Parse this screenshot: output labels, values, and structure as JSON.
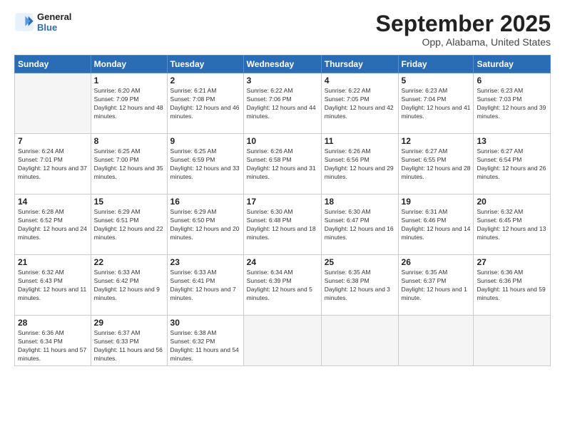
{
  "logo": {
    "line1": "General",
    "line2": "Blue"
  },
  "header": {
    "month": "September 2025",
    "location": "Opp, Alabama, United States"
  },
  "weekdays": [
    "Sunday",
    "Monday",
    "Tuesday",
    "Wednesday",
    "Thursday",
    "Friday",
    "Saturday"
  ],
  "weeks": [
    [
      {
        "day": "",
        "empty": true
      },
      {
        "day": "1",
        "sunrise": "6:20 AM",
        "sunset": "7:09 PM",
        "daylight": "12 hours and 48 minutes."
      },
      {
        "day": "2",
        "sunrise": "6:21 AM",
        "sunset": "7:08 PM",
        "daylight": "12 hours and 46 minutes."
      },
      {
        "day": "3",
        "sunrise": "6:22 AM",
        "sunset": "7:06 PM",
        "daylight": "12 hours and 44 minutes."
      },
      {
        "day": "4",
        "sunrise": "6:22 AM",
        "sunset": "7:05 PM",
        "daylight": "12 hours and 42 minutes."
      },
      {
        "day": "5",
        "sunrise": "6:23 AM",
        "sunset": "7:04 PM",
        "daylight": "12 hours and 41 minutes."
      },
      {
        "day": "6",
        "sunrise": "6:23 AM",
        "sunset": "7:03 PM",
        "daylight": "12 hours and 39 minutes."
      }
    ],
    [
      {
        "day": "7",
        "sunrise": "6:24 AM",
        "sunset": "7:01 PM",
        "daylight": "12 hours and 37 minutes."
      },
      {
        "day": "8",
        "sunrise": "6:25 AM",
        "sunset": "7:00 PM",
        "daylight": "12 hours and 35 minutes."
      },
      {
        "day": "9",
        "sunrise": "6:25 AM",
        "sunset": "6:59 PM",
        "daylight": "12 hours and 33 minutes."
      },
      {
        "day": "10",
        "sunrise": "6:26 AM",
        "sunset": "6:58 PM",
        "daylight": "12 hours and 31 minutes."
      },
      {
        "day": "11",
        "sunrise": "6:26 AM",
        "sunset": "6:56 PM",
        "daylight": "12 hours and 29 minutes."
      },
      {
        "day": "12",
        "sunrise": "6:27 AM",
        "sunset": "6:55 PM",
        "daylight": "12 hours and 28 minutes."
      },
      {
        "day": "13",
        "sunrise": "6:27 AM",
        "sunset": "6:54 PM",
        "daylight": "12 hours and 26 minutes."
      }
    ],
    [
      {
        "day": "14",
        "sunrise": "6:28 AM",
        "sunset": "6:52 PM",
        "daylight": "12 hours and 24 minutes."
      },
      {
        "day": "15",
        "sunrise": "6:29 AM",
        "sunset": "6:51 PM",
        "daylight": "12 hours and 22 minutes."
      },
      {
        "day": "16",
        "sunrise": "6:29 AM",
        "sunset": "6:50 PM",
        "daylight": "12 hours and 20 minutes."
      },
      {
        "day": "17",
        "sunrise": "6:30 AM",
        "sunset": "6:48 PM",
        "daylight": "12 hours and 18 minutes."
      },
      {
        "day": "18",
        "sunrise": "6:30 AM",
        "sunset": "6:47 PM",
        "daylight": "12 hours and 16 minutes."
      },
      {
        "day": "19",
        "sunrise": "6:31 AM",
        "sunset": "6:46 PM",
        "daylight": "12 hours and 14 minutes."
      },
      {
        "day": "20",
        "sunrise": "6:32 AM",
        "sunset": "6:45 PM",
        "daylight": "12 hours and 13 minutes."
      }
    ],
    [
      {
        "day": "21",
        "sunrise": "6:32 AM",
        "sunset": "6:43 PM",
        "daylight": "12 hours and 11 minutes."
      },
      {
        "day": "22",
        "sunrise": "6:33 AM",
        "sunset": "6:42 PM",
        "daylight": "12 hours and 9 minutes."
      },
      {
        "day": "23",
        "sunrise": "6:33 AM",
        "sunset": "6:41 PM",
        "daylight": "12 hours and 7 minutes."
      },
      {
        "day": "24",
        "sunrise": "6:34 AM",
        "sunset": "6:39 PM",
        "daylight": "12 hours and 5 minutes."
      },
      {
        "day": "25",
        "sunrise": "6:35 AM",
        "sunset": "6:38 PM",
        "daylight": "12 hours and 3 minutes."
      },
      {
        "day": "26",
        "sunrise": "6:35 AM",
        "sunset": "6:37 PM",
        "daylight": "12 hours and 1 minute."
      },
      {
        "day": "27",
        "sunrise": "6:36 AM",
        "sunset": "6:36 PM",
        "daylight": "11 hours and 59 minutes."
      }
    ],
    [
      {
        "day": "28",
        "sunrise": "6:36 AM",
        "sunset": "6:34 PM",
        "daylight": "11 hours and 57 minutes."
      },
      {
        "day": "29",
        "sunrise": "6:37 AM",
        "sunset": "6:33 PM",
        "daylight": "11 hours and 56 minutes."
      },
      {
        "day": "30",
        "sunrise": "6:38 AM",
        "sunset": "6:32 PM",
        "daylight": "11 hours and 54 minutes."
      },
      {
        "day": "",
        "empty": true
      },
      {
        "day": "",
        "empty": true
      },
      {
        "day": "",
        "empty": true
      },
      {
        "day": "",
        "empty": true
      }
    ]
  ]
}
